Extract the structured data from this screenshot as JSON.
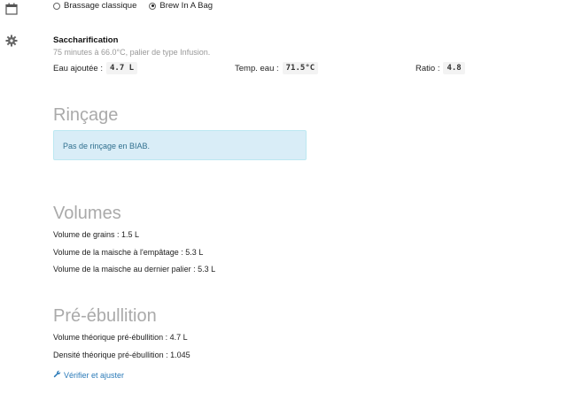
{
  "sidebar": {
    "calendar_icon": "calendar-icon",
    "settings_icon": "gear-icon"
  },
  "method": {
    "options": [
      {
        "label": "Brassage classique",
        "selected": false
      },
      {
        "label": "Brew In A Bag",
        "selected": true
      }
    ]
  },
  "step": {
    "title": "Saccharification",
    "description": "75 minutes à 66.0°C, palier de type Infusion.",
    "params": [
      {
        "label": "Eau ajoutée :",
        "value": "4.7 L"
      },
      {
        "label": "Temp. eau :",
        "value": "71.5°C"
      },
      {
        "label": "Ratio :",
        "value": "4.8"
      }
    ]
  },
  "rincage": {
    "heading": "Rinçage",
    "info": "Pas de rinçage en BIAB."
  },
  "volumes": {
    "heading": "Volumes",
    "lines": [
      "Volume de grains : 1.5 L",
      "Volume de la maische à l'empâtage : 5.3 L",
      "Volume de la maische au dernier palier : 5.3 L"
    ]
  },
  "pre_ebullition": {
    "heading": "Pré-ébullition",
    "lines": [
      "Volume théorique pré-ébullition : 4.7 L",
      "Densité théorique pré-ébullition : 1.045"
    ],
    "link_label": "Vérifier et ajuster",
    "link_icon": "wrench-icon"
  },
  "colors": {
    "info_bg": "#d9edf7",
    "info_text": "#31708f",
    "heading": "#aaaaaa",
    "link": "#2a7ab8"
  }
}
